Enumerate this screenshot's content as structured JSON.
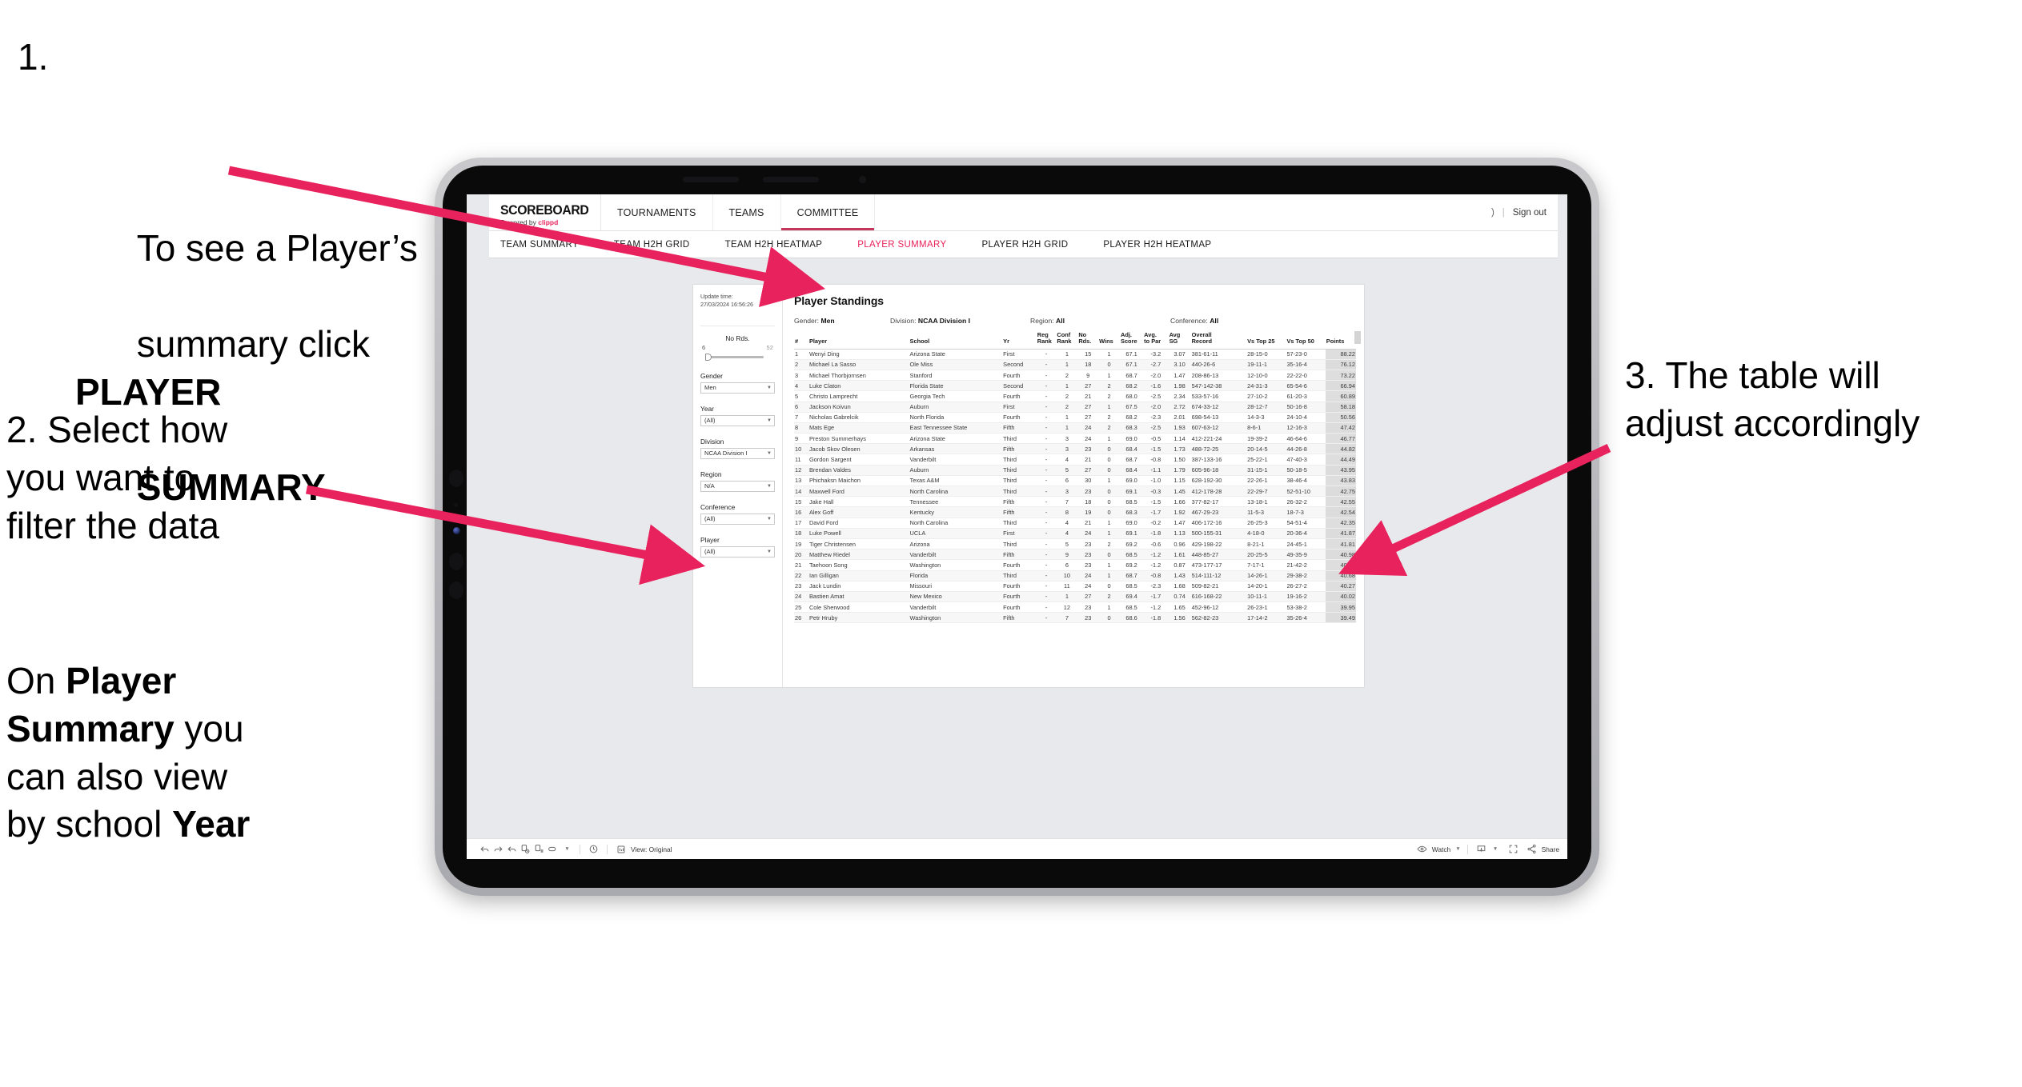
{
  "annotations": {
    "one": {
      "number": "1.",
      "line1": "To see a Player’s",
      "line2_pre": "summary click ",
      "line2_bold": "PLAYER",
      "line3_bold": "SUMMARY"
    },
    "two": {
      "text": "2. Select how\nyou want to\nfilter the data"
    },
    "two_b": {
      "pre": "On ",
      "bold1": "Player\nSummary",
      "mid": " you\ncan also view\nby school ",
      "bold2": "Year"
    },
    "three": {
      "text": "3. The table will\nadjust accordingly"
    }
  },
  "header": {
    "logo_main": "SCOREBOARD",
    "logo_sub_pre": "Powered by ",
    "logo_sub_brand": "clippd",
    "nav": [
      {
        "label": "TOURNAMENTS"
      },
      {
        "label": "TEAMS"
      },
      {
        "label": "COMMITTEE"
      }
    ],
    "user_chip": ")",
    "separator": "|",
    "sign_out": "Sign out"
  },
  "subnav": {
    "tabs": [
      {
        "label": "TEAM SUMMARY",
        "active": false
      },
      {
        "label": "TEAM H2H GRID",
        "active": false
      },
      {
        "label": "TEAM H2H HEATMAP",
        "active": false
      },
      {
        "label": "PLAYER SUMMARY",
        "active": true
      },
      {
        "label": "PLAYER H2H GRID",
        "active": false
      },
      {
        "label": "PLAYER H2H HEATMAP",
        "active": false
      }
    ],
    "active_color": "#e8225c"
  },
  "filters": {
    "update_label": "Update time:",
    "update_value": "27/03/2024 16:56:26",
    "slider": {
      "label": "No Rds.",
      "min": "6",
      "max": "52"
    },
    "groups": [
      {
        "label": "Gender",
        "value": "Men"
      },
      {
        "label": "Year",
        "value": "(All)"
      },
      {
        "label": "Division",
        "value": "NCAA Division I"
      },
      {
        "label": "Region",
        "value": "N/A"
      },
      {
        "label": "Conference",
        "value": "(All)"
      },
      {
        "label": "Player",
        "value": "(All)"
      }
    ]
  },
  "card": {
    "title": "Player Standings",
    "summary": [
      {
        "key": "Gender:",
        "value": "Men"
      },
      {
        "key": "Division:",
        "value": "NCAA Division I"
      },
      {
        "key": "Region:",
        "value": "All"
      },
      {
        "key": "Conference:",
        "value": "All"
      }
    ]
  },
  "chart_data": {
    "type": "table",
    "title": "Player Standings",
    "columns": [
      "#",
      "Player",
      "School",
      "Yr",
      "Reg Rank",
      "Conf Rank",
      "No Rds.",
      "Wins",
      "Adj. Score",
      "Avg. to Par",
      "Avg SG",
      "Overall Record",
      "Vs Top 25",
      "Vs Top 50",
      "Points"
    ],
    "rows": [
      [
        "1",
        "Wenyi Ding",
        "Arizona State",
        "First",
        "-",
        "1",
        "15",
        "1",
        "67.1",
        "-3.2",
        "3.07",
        "381-61-11",
        "28-15-0",
        "57-23-0",
        "88.22"
      ],
      [
        "2",
        "Michael La Sasso",
        "Ole Miss",
        "Second",
        "-",
        "1",
        "18",
        "0",
        "67.1",
        "-2.7",
        "3.10",
        "440-26-6",
        "19-11-1",
        "35-16-4",
        "76.12"
      ],
      [
        "3",
        "Michael Thorbjornsen",
        "Stanford",
        "Fourth",
        "-",
        "2",
        "9",
        "1",
        "68.7",
        "-2.0",
        "1.47",
        "208-86-13",
        "12-10-0",
        "22-22-0",
        "73.22"
      ],
      [
        "4",
        "Luke Claton",
        "Florida State",
        "Second",
        "-",
        "1",
        "27",
        "2",
        "68.2",
        "-1.6",
        "1.98",
        "547-142-38",
        "24-31-3",
        "65-54-6",
        "66.94"
      ],
      [
        "5",
        "Christo Lamprecht",
        "Georgia Tech",
        "Fourth",
        "-",
        "2",
        "21",
        "2",
        "68.0",
        "-2.5",
        "2.34",
        "533-57-16",
        "27-10-2",
        "61-20-3",
        "60.89"
      ],
      [
        "6",
        "Jackson Koivun",
        "Auburn",
        "First",
        "-",
        "2",
        "27",
        "1",
        "67.5",
        "-2.0",
        "2.72",
        "674-33-12",
        "28-12-7",
        "50-16-8",
        "58.18"
      ],
      [
        "7",
        "Nicholas Gabrelcik",
        "North Florida",
        "Fourth",
        "-",
        "1",
        "27",
        "2",
        "68.2",
        "-2.3",
        "2.01",
        "698-54-13",
        "14-3-3",
        "24-10-4",
        "50.56"
      ],
      [
        "8",
        "Mats Ege",
        "East Tennessee State",
        "Fifth",
        "-",
        "1",
        "24",
        "2",
        "68.3",
        "-2.5",
        "1.93",
        "607-63-12",
        "8-6-1",
        "12-16-3",
        "47.42"
      ],
      [
        "9",
        "Preston Summerhays",
        "Arizona State",
        "Third",
        "-",
        "3",
        "24",
        "1",
        "69.0",
        "-0.5",
        "1.14",
        "412-221-24",
        "19-39-2",
        "46-64-6",
        "46.77"
      ],
      [
        "10",
        "Jacob Skov Olesen",
        "Arkansas",
        "Fifth",
        "-",
        "3",
        "23",
        "0",
        "68.4",
        "-1.5",
        "1.73",
        "488-72-25",
        "20-14-5",
        "44-26-8",
        "44.82"
      ],
      [
        "11",
        "Gordon Sargent",
        "Vanderbilt",
        "Third",
        "-",
        "4",
        "21",
        "0",
        "68.7",
        "-0.8",
        "1.50",
        "387-133-16",
        "25-22-1",
        "47-40-3",
        "44.49"
      ],
      [
        "12",
        "Brendan Valdes",
        "Auburn",
        "Third",
        "-",
        "5",
        "27",
        "0",
        "68.4",
        "-1.1",
        "1.79",
        "605-96-18",
        "31-15-1",
        "50-18-5",
        "43.95"
      ],
      [
        "13",
        "Phichaksn Maichon",
        "Texas A&M",
        "Third",
        "-",
        "6",
        "30",
        "1",
        "69.0",
        "-1.0",
        "1.15",
        "628-192-30",
        "22-26-1",
        "38-46-4",
        "43.83"
      ],
      [
        "14",
        "Maxwell Ford",
        "North Carolina",
        "Third",
        "-",
        "3",
        "23",
        "0",
        "69.1",
        "-0.3",
        "1.45",
        "412-178-28",
        "22-29-7",
        "52-51-10",
        "42.75"
      ],
      [
        "15",
        "Jake Hall",
        "Tennessee",
        "Fifth",
        "-",
        "7",
        "18",
        "0",
        "68.5",
        "-1.5",
        "1.66",
        "377-82-17",
        "13-18-1",
        "26-32-2",
        "42.55"
      ],
      [
        "16",
        "Alex Goff",
        "Kentucky",
        "Fifth",
        "-",
        "8",
        "19",
        "0",
        "68.3",
        "-1.7",
        "1.92",
        "467-29-23",
        "11-5-3",
        "18-7-3",
        "42.54"
      ],
      [
        "17",
        "David Ford",
        "North Carolina",
        "Third",
        "-",
        "4",
        "21",
        "1",
        "69.0",
        "-0.2",
        "1.47",
        "406-172-16",
        "26-25-3",
        "54-51-4",
        "42.35"
      ],
      [
        "18",
        "Luke Powell",
        "UCLA",
        "First",
        "-",
        "4",
        "24",
        "1",
        "69.1",
        "-1.8",
        "1.13",
        "500-155-31",
        "4-18-0",
        "20-36-4",
        "41.87"
      ],
      [
        "19",
        "Tiger Christensen",
        "Arizona",
        "Third",
        "-",
        "5",
        "23",
        "2",
        "69.2",
        "-0.6",
        "0.96",
        "429-198-22",
        "8-21-1",
        "24-45-1",
        "41.81"
      ],
      [
        "20",
        "Matthew Riedel",
        "Vanderbilt",
        "Fifth",
        "-",
        "9",
        "23",
        "0",
        "68.5",
        "-1.2",
        "1.61",
        "448-85-27",
        "20-25-5",
        "49-35-9",
        "40.98"
      ],
      [
        "21",
        "Taehoon Song",
        "Washington",
        "Fourth",
        "-",
        "6",
        "23",
        "1",
        "69.2",
        "-1.2",
        "0.87",
        "473-177-17",
        "7-17-1",
        "21-42-2",
        "40.88"
      ],
      [
        "22",
        "Ian Gilligan",
        "Florida",
        "Third",
        "-",
        "10",
        "24",
        "1",
        "68.7",
        "-0.8",
        "1.43",
        "514-111-12",
        "14-26-1",
        "29-38-2",
        "40.68"
      ],
      [
        "23",
        "Jack Lundin",
        "Missouri",
        "Fourth",
        "-",
        "11",
        "24",
        "0",
        "68.5",
        "-2.3",
        "1.68",
        "509-82-21",
        "14-20-1",
        "26-27-2",
        "40.27"
      ],
      [
        "24",
        "Bastien Amat",
        "New Mexico",
        "Fourth",
        "-",
        "1",
        "27",
        "2",
        "69.4",
        "-1.7",
        "0.74",
        "616-168-22",
        "10-11-1",
        "19-16-2",
        "40.02"
      ],
      [
        "25",
        "Cole Sherwood",
        "Vanderbilt",
        "Fourth",
        "-",
        "12",
        "23",
        "1",
        "68.5",
        "-1.2",
        "1.65",
        "452-96-12",
        "26-23-1",
        "53-38-2",
        "39.95"
      ],
      [
        "26",
        "Petr Hruby",
        "Washington",
        "Fifth",
        "-",
        "7",
        "23",
        "0",
        "68.6",
        "-1.8",
        "1.56",
        "562-82-23",
        "17-14-2",
        "35-26-4",
        "39.49"
      ]
    ]
  },
  "toolbar": {
    "undo": "undo-icon",
    "redo": "redo-icon",
    "reset": "reset-icon",
    "refresh": "refresh-data-icon",
    "pause": "pause-auto-updates-icon",
    "view_original_label": "View: Original",
    "watch_label": "Watch",
    "share_label": "Share"
  },
  "colors": {
    "accent_pink": "#e8225c",
    "arrow_pink": "#e8225c",
    "screen_bg": "#e8e9ec"
  }
}
